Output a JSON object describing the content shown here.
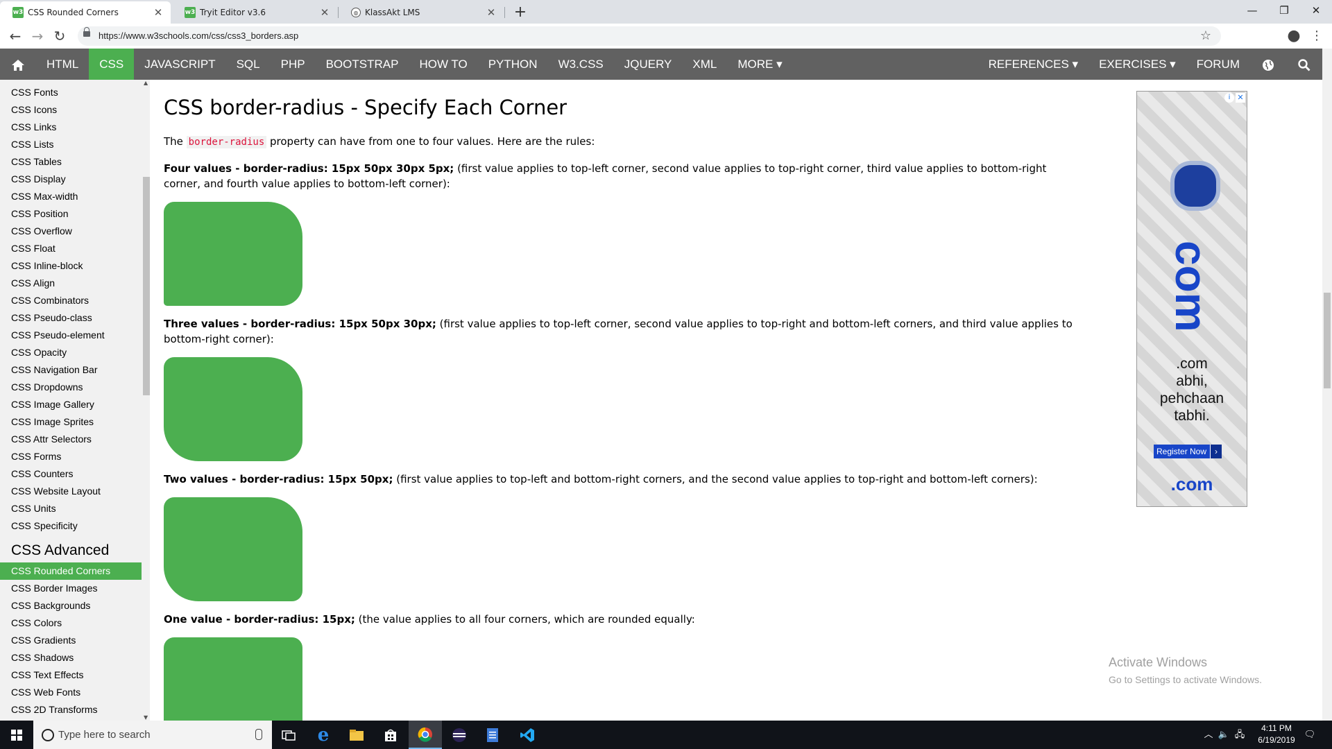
{
  "browser": {
    "tabs": [
      {
        "title": "CSS Rounded Corners",
        "favicon": "w3schools-icon",
        "active": true
      },
      {
        "title": "Tryit Editor v3.6",
        "favicon": "w3schools-icon",
        "active": false
      },
      {
        "title": "KlassAkt LMS",
        "favicon": "globe-icon",
        "active": false
      }
    ],
    "new_tab": "+",
    "url": "https://www.w3schools.com/css/css3_borders.asp"
  },
  "topnav": {
    "left_items": [
      "HTML",
      "CSS",
      "JAVASCRIPT",
      "SQL",
      "PHP",
      "BOOTSTRAP",
      "HOW TO",
      "PYTHON",
      "W3.CSS",
      "JQUERY",
      "XML",
      "MORE ▾"
    ],
    "active": "CSS",
    "right_items": [
      "REFERENCES ▾",
      "EXERCISES ▾",
      "FORUM"
    ]
  },
  "sidebar": {
    "items_top": [
      "CSS Fonts",
      "CSS Icons",
      "CSS Links",
      "CSS Lists",
      "CSS Tables",
      "CSS Display",
      "CSS Max-width",
      "CSS Position",
      "CSS Overflow",
      "CSS Float",
      "CSS Inline-block",
      "CSS Align",
      "CSS Combinators",
      "CSS Pseudo-class",
      "CSS Pseudo-element",
      "CSS Opacity",
      "CSS Navigation Bar",
      "CSS Dropdowns",
      "CSS Image Gallery",
      "CSS Image Sprites",
      "CSS Attr Selectors",
      "CSS Forms",
      "CSS Counters",
      "CSS Website Layout",
      "CSS Units",
      "CSS Specificity"
    ],
    "heading": "CSS Advanced",
    "items_bottom": [
      "CSS Rounded Corners",
      "CSS Border Images",
      "CSS Backgrounds",
      "CSS Colors",
      "CSS Gradients",
      "CSS Shadows",
      "CSS Text Effects",
      "CSS Web Fonts",
      "CSS 2D Transforms"
    ],
    "active": "CSS Rounded Corners"
  },
  "main": {
    "title": "CSS border-radius - Specify Each Corner",
    "intro_before": "The ",
    "intro_code": "border-radius",
    "intro_after": " property can have from one to four values. Here are the rules:",
    "sections": [
      {
        "bold": "Four values - border-radius: 15px 50px 30px 5px;",
        "text": " (first value applies to top-left corner, second value applies to top-right corner, third value applies to bottom-right corner, and fourth value applies to bottom-left corner):"
      },
      {
        "bold": "Three values - border-radius: 15px 50px 30px;",
        "text": " (first value applies to top-left corner, second value applies to top-right and bottom-left corners, and third value applies to bottom-right corner):"
      },
      {
        "bold": "Two values - border-radius: 15px 50px;",
        "text": " (first value applies to top-left and bottom-right corners, and the second value applies to top-right and bottom-left corners):"
      },
      {
        "bold": "One value - border-radius: 15px;",
        "text": " (the value applies to all four corners, which are rounded equally:"
      }
    ],
    "box_color": "#4CAF50"
  },
  "ad": {
    "big_text": "com",
    "tagline": [
      ".com",
      "abhi,",
      "pehchaan",
      "tabhi."
    ],
    "button": "Register Now",
    "logo": ".com"
  },
  "watermark": {
    "title": "Activate Windows",
    "subtitle": "Go to Settings to activate Windows."
  },
  "taskbar": {
    "search_placeholder": "Type here to search",
    "time": "4:11 PM",
    "date": "6/19/2019"
  }
}
